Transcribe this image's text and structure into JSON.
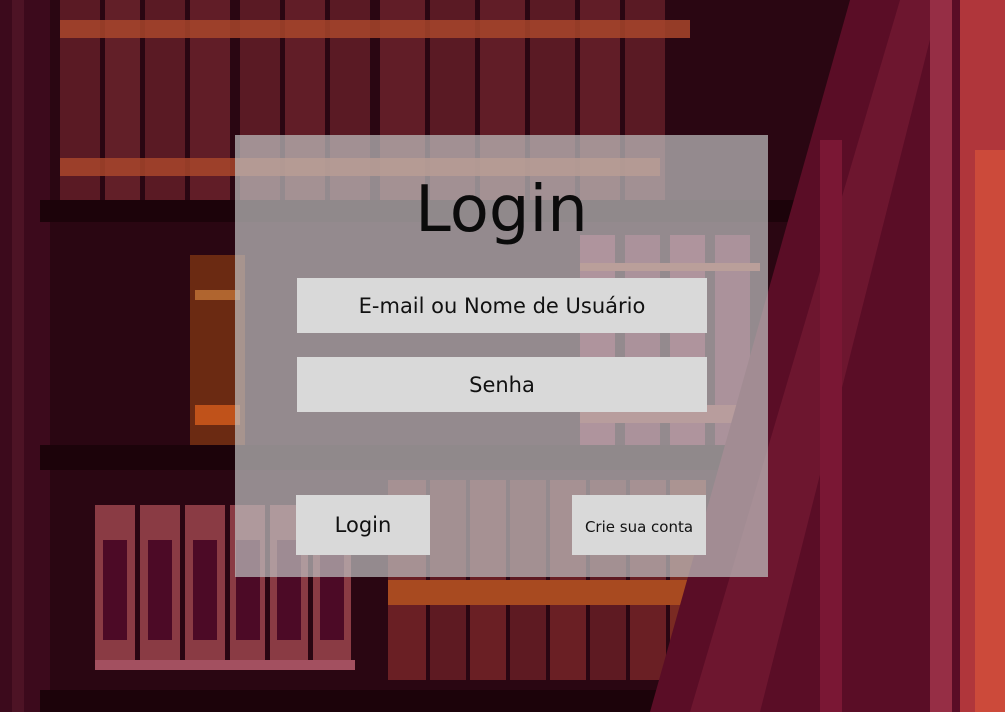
{
  "login_card": {
    "title": "Login",
    "email_placeholder": "E-mail ou Nome de Usuário",
    "password_placeholder": "Senha",
    "login_button_label": "Login",
    "signup_button_label": "Crie sua conta"
  },
  "colors": {
    "background": "#2a0612",
    "card_overlay": "#bebebe",
    "field_fill": "#d9d9d9",
    "text": "#111111"
  }
}
